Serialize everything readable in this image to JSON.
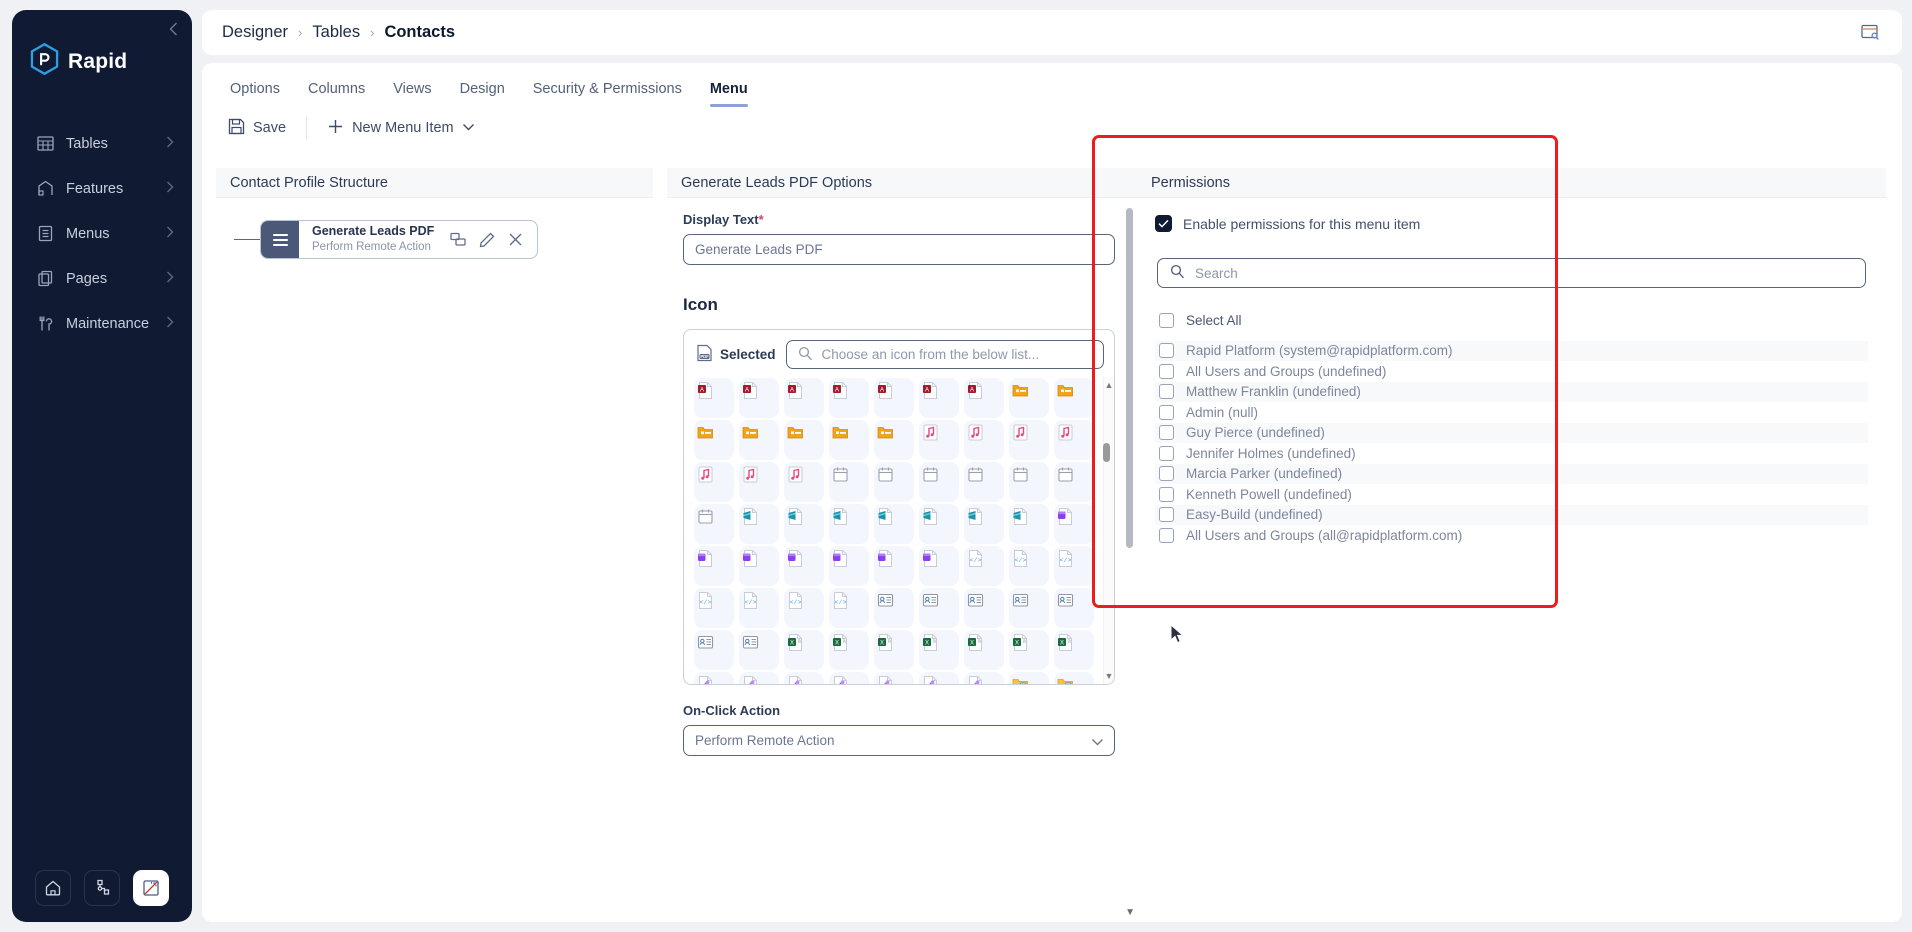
{
  "sidebar": {
    "brand": "Rapid",
    "collapse_icon": "chevron-left-icon",
    "items": [
      {
        "label": "Tables",
        "icon": "table-icon"
      },
      {
        "label": "Features",
        "icon": "features-icon"
      },
      {
        "label": "Menus",
        "icon": "menu-list-icon"
      },
      {
        "label": "Pages",
        "icon": "pages-icon"
      },
      {
        "label": "Maintenance",
        "icon": "maintenance-icon"
      }
    ],
    "bottom_buttons": [
      {
        "name": "home-icon",
        "active": false
      },
      {
        "name": "sitemap-icon",
        "active": false
      },
      {
        "name": "designer-ruler-icon",
        "active": true
      }
    ]
  },
  "topbar": {
    "breadcrumbs": [
      "Designer",
      "Tables",
      "Contacts"
    ],
    "separator": "›",
    "preview_icon": "window-preview-icon"
  },
  "tabs": [
    {
      "label": "Options",
      "active": false
    },
    {
      "label": "Columns",
      "active": false
    },
    {
      "label": "Views",
      "active": false
    },
    {
      "label": "Design",
      "active": false
    },
    {
      "label": "Security & Permissions",
      "active": false
    },
    {
      "label": "Menu",
      "active": true
    }
  ],
  "toolbar": {
    "save_label": "Save",
    "save_icon": "save-disk-icon",
    "new_menu_item_label": "New Menu Item",
    "new_menu_item_icon": "plus-icon",
    "new_menu_item_caret": "chevron-down-icon"
  },
  "left_panel": {
    "title": "Contact Profile Structure",
    "menu_item": {
      "title": "Generate Leads PDF",
      "subtitle": "Perform Remote Action",
      "handle_icon": "drag-handle-icon",
      "actions": [
        {
          "name": "duplicate-icon"
        },
        {
          "name": "edit-pencil-icon"
        },
        {
          "name": "close-x-icon"
        }
      ]
    }
  },
  "center_panel": {
    "title": "Generate Leads PDF Options",
    "display_text": {
      "label": "Display Text",
      "required_marker": "*",
      "value": "Generate Leads PDF"
    },
    "icon_section": {
      "heading": "Icon",
      "selected_label": "Selected",
      "selected_icon": "pdf-file-icon",
      "search_placeholder": "Choose an icon from the below list...",
      "search_icon": "search-icon",
      "grid_rows": [
        [
          "doc-a-red",
          "doc-a-red",
          "doc-a-red",
          "doc-a-red",
          "doc-a-red",
          "doc-a-red",
          "doc-a-red",
          "folder-yellow",
          "folder-yellow"
        ],
        [
          "folder-yellow",
          "folder-yellow",
          "folder-yellow",
          "folder-yellow",
          "folder-yellow",
          "music-pink",
          "music-pink",
          "music-pink",
          "music-pink"
        ],
        [
          "music-pink",
          "music-pink",
          "music-pink",
          "calendar-gray",
          "calendar-gray",
          "calendar-gray",
          "calendar-gray",
          "calendar-gray",
          "calendar-gray"
        ],
        [
          "calendar-gray",
          "doc-teal",
          "doc-teal",
          "doc-teal",
          "doc-teal",
          "doc-teal",
          "doc-teal",
          "doc-teal",
          "doc-purple"
        ],
        [
          "doc-purple",
          "doc-purple",
          "doc-purple",
          "doc-purple",
          "doc-purple",
          "doc-purple",
          "doc-code",
          "doc-code",
          "doc-code"
        ],
        [
          "doc-code",
          "doc-code",
          "doc-code",
          "doc-code",
          "doc-contact",
          "doc-contact",
          "doc-contact",
          "doc-contact",
          "doc-contact"
        ],
        [
          "doc-contact",
          "doc-contact",
          "doc-excel",
          "doc-excel",
          "doc-excel",
          "doc-excel",
          "doc-excel",
          "doc-excel",
          "doc-excel"
        ],
        [
          "doc-magic",
          "doc-magic",
          "doc-magic",
          "doc-magic",
          "doc-magic",
          "doc-magic",
          "doc-magic",
          "folder-screen",
          "folder-screen"
        ]
      ],
      "scroll_up_icon": "caret-up-icon",
      "scroll_down_icon": "caret-down-icon"
    },
    "on_click_action": {
      "label": "On-Click Action",
      "value": "Perform Remote Action",
      "caret_icon": "chevron-down-icon"
    }
  },
  "right_panel": {
    "title": "Permissions",
    "enable_checkbox": {
      "label": "Enable permissions for this menu item",
      "checked": true
    },
    "search_placeholder": "Search",
    "search_icon": "search-icon",
    "select_all": {
      "label": "Select All",
      "checked": false
    },
    "rows": [
      {
        "label": "Rapid Platform (system@rapidplatform.com)",
        "checked": false
      },
      {
        "label": "All Users and Groups (undefined)",
        "checked": false
      },
      {
        "label": "Matthew Franklin (undefined)",
        "checked": false
      },
      {
        "label": "Admin (null)",
        "checked": false
      },
      {
        "label": "Guy Pierce (undefined)",
        "checked": false
      },
      {
        "label": "Jennifer Holmes (undefined)",
        "checked": false
      },
      {
        "label": "Marcia Parker (undefined)",
        "checked": false
      },
      {
        "label": "Kenneth Powell (undefined)",
        "checked": false
      },
      {
        "label": "Easy-Build (undefined)",
        "checked": false
      },
      {
        "label": "All Users and Groups (all@rapidplatform.com)",
        "checked": false
      }
    ],
    "highlight_color": "#ee1c1c"
  }
}
